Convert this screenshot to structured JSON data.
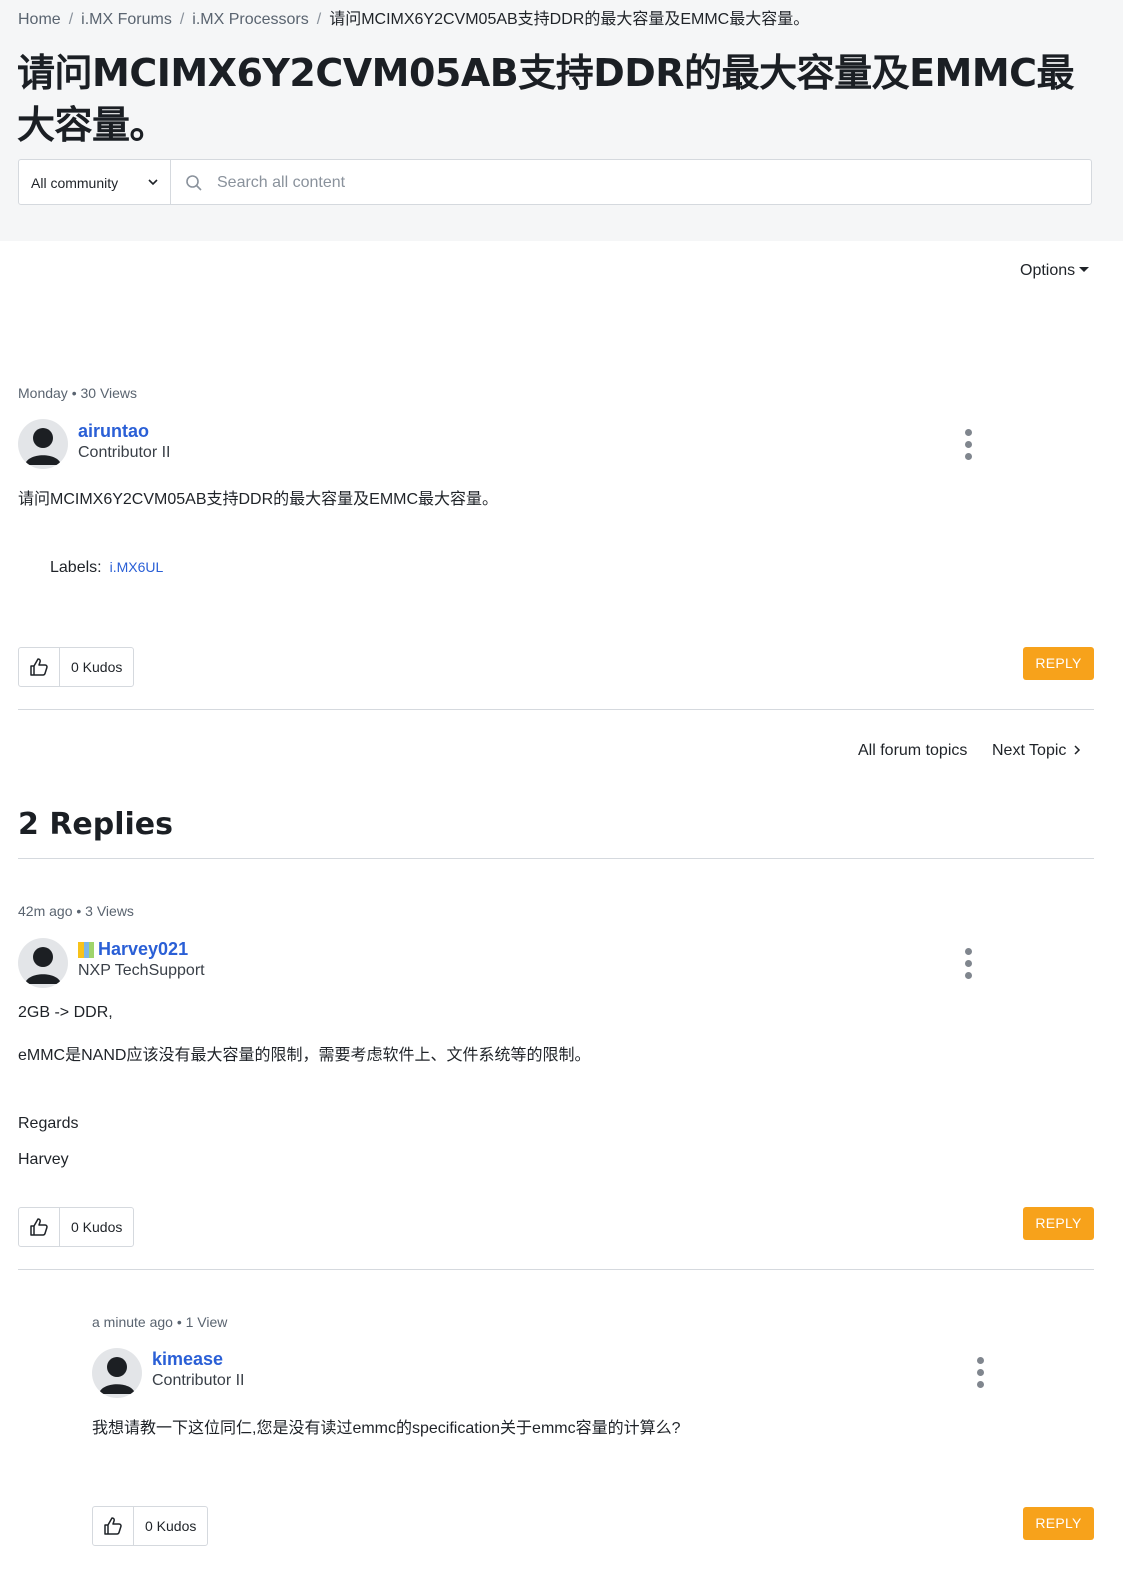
{
  "breadcrumb": {
    "items": [
      "Home",
      "i.MX Forums",
      "i.MX Processors"
    ],
    "current": "请问MCIMX6Y2CVM05AB支持DDR的最大容量及EMMC最大容量。"
  },
  "page_title": "请问MCIMX6Y2CVM05AB支持DDR的最大容量及EMMC最大容量。",
  "search": {
    "scope": "All community",
    "placeholder": "Search all content"
  },
  "options_label": "Options",
  "topic": {
    "meta": "Monday • 30 Views",
    "author": "airuntao",
    "rank": "Contributor II",
    "body": "请问MCIMX6Y2CVM05AB支持DDR的最大容量及EMMC最大容量。",
    "labels_label": "Labels:",
    "label_tag": "i.MX6UL",
    "kudos": "0 Kudos",
    "reply": "REPLY"
  },
  "nav": {
    "all_topics": "All forum topics",
    "next_topic": "Next Topic"
  },
  "replies_title": "2 Replies",
  "replies": [
    {
      "meta": "42m ago • 3 Views",
      "author": "Harvey021",
      "rank": "NXP TechSupport",
      "lines": [
        "2GB -> DDR,",
        "eMMC是NAND应该没有最大容量的限制，需要考虑软件上、文件系统等的限制。",
        "Regards",
        "Harvey"
      ],
      "kudos": "0 Kudos",
      "reply": "REPLY"
    },
    {
      "meta": "a minute ago • 1 View",
      "author": "kimease",
      "rank": "Contributor II",
      "lines": [
        "我想请教一下这位同仁,您是没有读过emmc的specification关于emmc容量的计算么?"
      ],
      "kudos": "0 Kudos",
      "reply": "REPLY"
    }
  ],
  "colors": {
    "link": "#2a5fd6",
    "reply_button": "#f7a21b",
    "header_bg": "#f5f6f7"
  },
  "icons": [
    "search-icon",
    "chevron-down-icon",
    "caret-down-icon",
    "avatar-icon",
    "kebab-icon",
    "thumbs-up-icon",
    "chevron-right-icon",
    "rank-icon"
  ]
}
